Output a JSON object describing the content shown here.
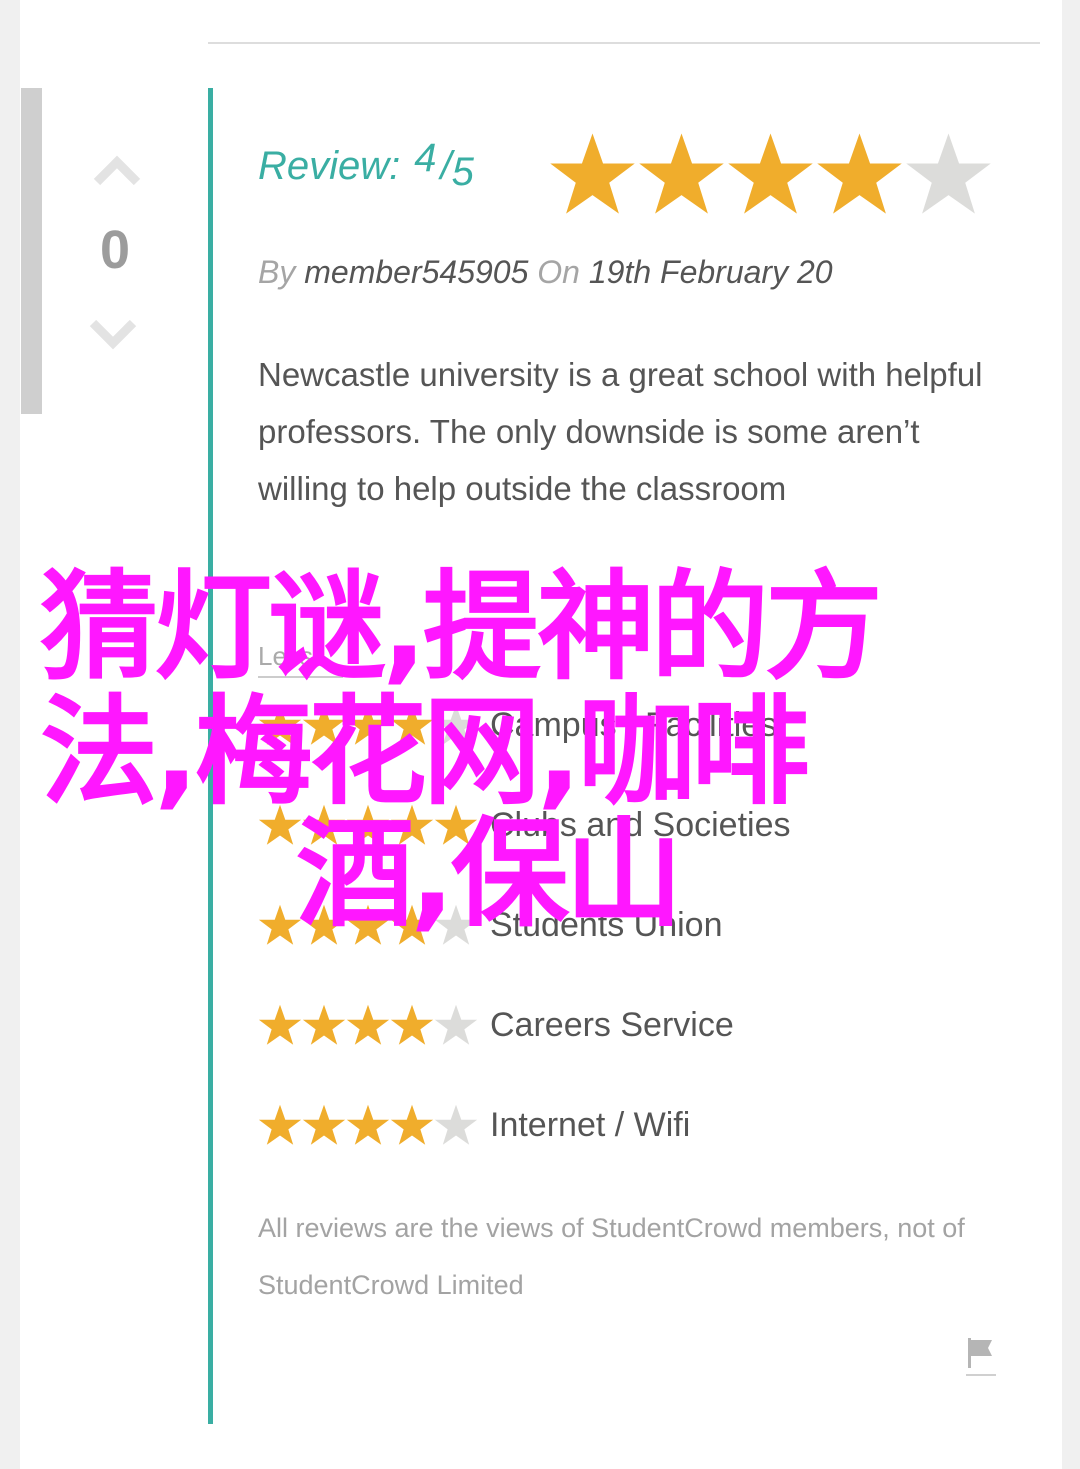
{
  "vote": {
    "count": "0"
  },
  "review": {
    "title_label": "Review:",
    "score": "4",
    "separator": "/",
    "out_of": "5",
    "rating": 4,
    "max_rating": 5,
    "meta": {
      "by_label": "By",
      "author": "member545905",
      "on_label": "On",
      "date": "19th February 20"
    },
    "body": "Newcastle university is a great school with helpful professors. The only downside is some aren’t willing to help outside the classroom",
    "less_link": "Less"
  },
  "category_ratings": [
    {
      "label": "Campus / Facilities",
      "rating": 4
    },
    {
      "label": "Clubs and Societies",
      "rating": 5
    },
    {
      "label": "Students Union",
      "rating": 4
    },
    {
      "label": "Careers Service",
      "rating": 4
    },
    {
      "label": "Internet / Wifi",
      "rating": 4
    }
  ],
  "disclaimer": "All reviews are the views of StudentCrowd members, not of StudentCrowd Limited",
  "overlay": {
    "line1": "猜灯谜,提神的方",
    "line2": "法,梅花网,咖啡",
    "line3": "酒,保山"
  },
  "colors": {
    "accent": "#3aaea3",
    "star_filled": "#f0ad2c",
    "star_empty": "#dcdcda",
    "overlay": "#ff17ff"
  },
  "icons": {
    "upvote": "chevron-up-icon",
    "downvote": "chevron-down-icon",
    "star": "star-icon",
    "report": "flag-icon"
  }
}
